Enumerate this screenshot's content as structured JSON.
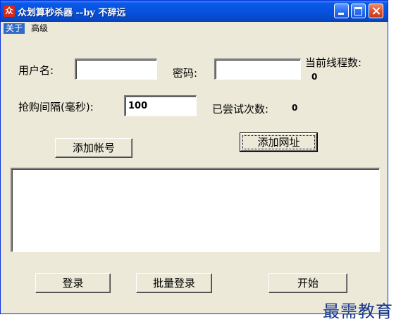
{
  "window": {
    "title": "众划算秒杀器 --by 不辞远",
    "icon_text": "众"
  },
  "menu": {
    "items": [
      {
        "label": "关于"
      },
      {
        "label": "高级"
      }
    ]
  },
  "form": {
    "username_label": "用户名:",
    "username_value": "",
    "password_label": "密码:",
    "password_value": "",
    "threads_label": "当前线程数:",
    "threads_value": "0",
    "interval_label": "抢购间隔(毫秒):",
    "interval_value": "100",
    "attempts_label": "已尝试次数:",
    "attempts_value": "0"
  },
  "buttons": {
    "add_account": "添加帐号",
    "add_url": "添加网址",
    "login": "登录",
    "batch_login": "批量登录",
    "start": "开始"
  },
  "watermark": "最需教育"
}
